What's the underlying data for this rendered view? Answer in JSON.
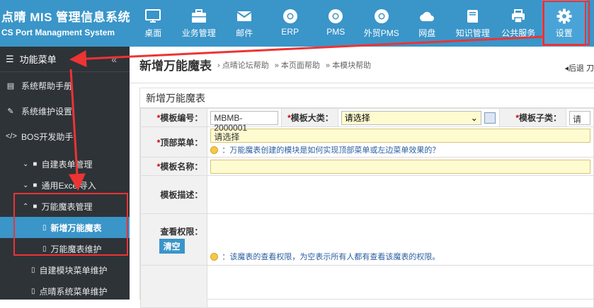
{
  "brand": {
    "title": "点晴 MIS 管理信息系统",
    "subtitle": "CS Port Managment System"
  },
  "nav": [
    {
      "label": "桌面",
      "icon": "monitor-icon"
    },
    {
      "label": "业务管理",
      "icon": "briefcase-icon"
    },
    {
      "label": "邮件",
      "icon": "mail-icon"
    },
    {
      "label": "ERP",
      "icon": "chrome-icon"
    },
    {
      "label": "PMS",
      "icon": "chrome-icon"
    },
    {
      "label": "外贸PMS",
      "icon": "chrome-icon"
    },
    {
      "label": "网盘",
      "icon": "cloud-icon"
    },
    {
      "label": "知识管理",
      "icon": "book-icon"
    },
    {
      "label": "公共服务",
      "icon": "printer-icon"
    },
    {
      "label": "设置",
      "icon": "gear-icon"
    }
  ],
  "sidebar": {
    "header": "功能菜单",
    "collapse": "«",
    "items": [
      {
        "label": "系统帮助手册"
      },
      {
        "label": "系统维护设置"
      },
      {
        "label": "BOS开发助手"
      }
    ],
    "sub": [
      {
        "label": "自建表单管理"
      },
      {
        "label": "通用Excel导入"
      },
      {
        "label": "万能魔表管理"
      }
    ],
    "leaf": [
      {
        "label": "新增万能魔表"
      },
      {
        "label": "万能魔表维护"
      }
    ],
    "more": [
      {
        "label": "自建模块菜单维护"
      },
      {
        "label": "点晴系统菜单维护"
      }
    ]
  },
  "header": {
    "title": "新增万能魔表",
    "crumbs": [
      "点晴论坛帮助",
      "本页面帮助",
      "本模块帮助"
    ],
    "back": "后退",
    "next": "刀"
  },
  "form": {
    "title": "新增万能魔表",
    "code_label": "模板编号：",
    "code_value": "MBMB-2000001",
    "category_label": "模板大类：",
    "category_value": "请选择",
    "subcategory_label": "模板子类：",
    "subcategory_value": "请",
    "top_menu_label": "顶部菜单：",
    "top_menu_value": "请选择",
    "top_menu_hint": "：万能魔表创建的模块是如何实现顶部菜单或左边菜单效果的？",
    "name_label": "模板名称：",
    "name_value": "",
    "desc_label": "模板描述：",
    "perm_label": "查看权限：",
    "clear_button": "清空",
    "perm_hint": "：该魔表的查看权限，为空表示所有人都有查看该魔表的权限。"
  },
  "colors": {
    "accent": "#3a95c9",
    "sidebar": "#2e3338",
    "highlight": "#e33333"
  }
}
